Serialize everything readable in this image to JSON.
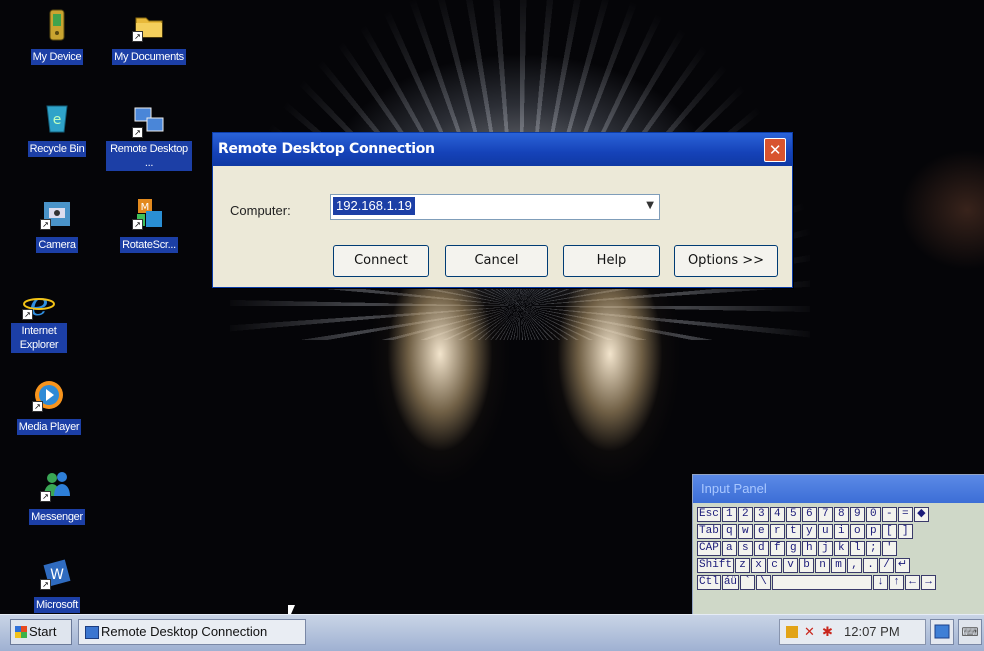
{
  "desktop": {
    "icons": [
      {
        "label": "My Device"
      },
      {
        "label": "My Documents"
      },
      {
        "label": "Recycle Bin"
      },
      {
        "label": "Remote Desktop ..."
      },
      {
        "label": "Camera"
      },
      {
        "label": "RotateScr..."
      },
      {
        "label": "Internet Explorer"
      },
      {
        "label": "Media Player"
      },
      {
        "label": "Messenger"
      },
      {
        "label": "Microsoft"
      }
    ]
  },
  "dialog": {
    "title": "Remote Desktop Connection",
    "close_glyph": "✕",
    "computer_label": "Computer:",
    "computer_value": "192.168.1.19",
    "buttons": {
      "connect": "Connect",
      "cancel": "Cancel",
      "help": "Help",
      "options": "Options >>"
    }
  },
  "input_panel": {
    "title": "Input Panel",
    "rows": [
      [
        "Esc",
        "1",
        "2",
        "3",
        "4",
        "5",
        "6",
        "7",
        "8",
        "9",
        "0",
        "-",
        "=",
        "◆"
      ],
      [
        "Tab",
        "q",
        "w",
        "e",
        "r",
        "t",
        "y",
        "u",
        "i",
        "o",
        "p",
        "[",
        "]"
      ],
      [
        "CAP",
        "a",
        "s",
        "d",
        "f",
        "g",
        "h",
        "j",
        "k",
        "l",
        ";",
        "'"
      ],
      [
        "Shift",
        "z",
        "x",
        "c",
        "v",
        "b",
        "n",
        "m",
        ",",
        ".",
        "/",
        "↵"
      ],
      [
        "Ctl",
        "áü",
        "`",
        "\\",
        " ",
        "↓",
        "↑",
        "←",
        "→"
      ]
    ]
  },
  "taskbar": {
    "start_label": "Start",
    "task_label": "Remote Desktop Connection",
    "clock": "12:07 PM"
  }
}
